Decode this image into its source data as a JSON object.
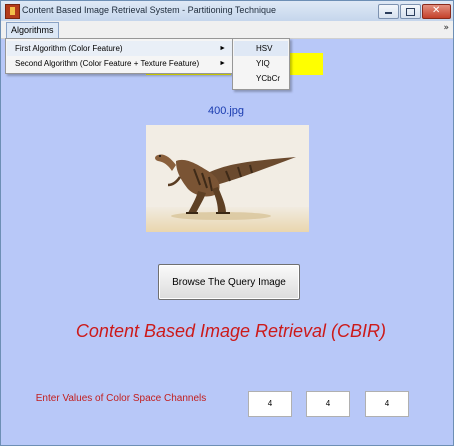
{
  "window": {
    "title": "Content Based Image Retrieval System - Partitioning Technique"
  },
  "menubar": {
    "algorithms_label": "Algorithms",
    "overflow_arrow": "»"
  },
  "algorithms_menu": {
    "items": [
      {
        "label": "First Algorithm (Color Feature)",
        "arrow": "►"
      },
      {
        "label": "Second Algorithm (Color Feature + Texture Feature)",
        "arrow": "►"
      }
    ]
  },
  "color_space_submenu": {
    "items": [
      "HSV",
      "YIQ",
      "YCbCr"
    ]
  },
  "query_image": {
    "filename": "400.jpg",
    "description": "dinosaur"
  },
  "browse_button": {
    "label": "Browse The Query  Image"
  },
  "heading": {
    "text": "Content Based Image Retrieval (CBIR)"
  },
  "channels": {
    "label": "Enter Values of Color Space Channels",
    "values": [
      "4",
      "4",
      "4"
    ]
  },
  "colors": {
    "background": "#b8c8f8",
    "heading": "#cc1a1a",
    "filename": "#1a3cb0",
    "highlight_box": "#ffff00"
  }
}
